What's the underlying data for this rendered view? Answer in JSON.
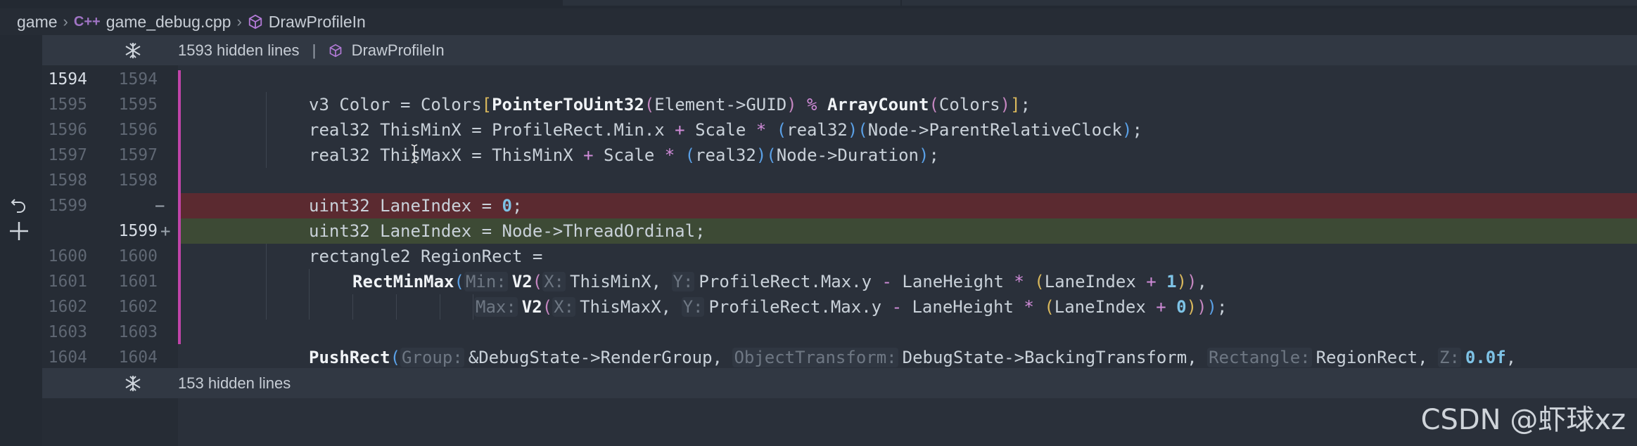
{
  "breadcrumb": {
    "folder": "game",
    "file_lang": "C++",
    "file": "game_debug.cpp",
    "symbol": "DrawProfileIn"
  },
  "top_fold": {
    "text": "1593 hidden lines",
    "divider": "|",
    "symbol": "DrawProfileIn"
  },
  "bottom_fold": {
    "text": "153 hidden lines"
  },
  "line_numbers": {
    "r1594_old": "1594",
    "r1594_new": "1594",
    "r1595_old": "1595",
    "r1595_new": "1595",
    "r1596_old": "1596",
    "r1596_new": "1596",
    "r1597_old": "1597",
    "r1597_new": "1597",
    "r1598_old": "1598",
    "r1598_new": "1598",
    "r1599_old": "1599",
    "r1599_new": "1599",
    "r1600_old": "1600",
    "r1600_new": "1600",
    "r1601_old": "1601",
    "r1601_new": "1601",
    "r1602_old": "1602",
    "r1602_new": "1602",
    "r1603_old": "1603",
    "r1603_new": "1603",
    "r1604_old": "1604",
    "r1604_new": "1604"
  },
  "diff_marks": {
    "removed": "−",
    "added": "+"
  },
  "code": {
    "l1595": {
      "a": "v3 Color = Colors",
      "b": "[",
      "c": "PointerToUint32",
      "d": "(",
      "e": "Element->GUID",
      "f": ")",
      "g": " % ",
      "h": "ArrayCount",
      "i": "(",
      "j": "Colors",
      "k": ")",
      "l": "]",
      "m": ";"
    },
    "l1596": {
      "a": "real32 ThisMinX = ProfileRect.Min.x ",
      "b": "+",
      "c": " Scale ",
      "d": "*",
      "e": " ",
      "f": "(",
      "g": "real32",
      "h": ")",
      "i": "(",
      "j": "Node->ParentRelativeClock",
      "k": ")",
      "l": ";"
    },
    "l1597": {
      "a": "real32 ThisMaxX = ThisMinX ",
      "b": "+",
      "c": " Scale ",
      "d": "*",
      "e": " ",
      "f": "(",
      "g": "real32",
      "h": ")",
      "i": "(",
      "j": "Node->Duration",
      "k": ")",
      "l": ";"
    },
    "l1599_del": {
      "a": "uint32 LaneIndex = ",
      "b": "0",
      "c": ";"
    },
    "l1599_add": {
      "a": "uint32 LaneIndex = Node->ThreadOrdinal;"
    },
    "l1600": {
      "a": "rectangle2 RegionRect ="
    },
    "l1601": {
      "fn": "RectMinMax",
      "p1": "(",
      "h1": "Min:",
      "fn2": "V2",
      "p2": "(",
      "h2": "X:",
      "a": "ThisMinX, ",
      "h3": "Y:",
      "b": "ProfileRect.Max.y ",
      "m": "-",
      "c": " LaneHeight ",
      "s": "*",
      "d": " ",
      "p3": "(",
      "e": "LaneIndex ",
      "pl": "+",
      "f": " ",
      "n": "1",
      "p4": ")",
      "p5": ")",
      "g": ","
    },
    "l1602": {
      "h1": "Max:",
      "fn2": "V2",
      "p2": "(",
      "h2": "X:",
      "a": "ThisMaxX, ",
      "h3": "Y:",
      "b": "ProfileRect.Max.y ",
      "m": "-",
      "c": " LaneHeight ",
      "s": "*",
      "d": " ",
      "p3": "(",
      "e": "LaneIndex ",
      "pl": "+",
      "f": " ",
      "n": "0",
      "p4": ")",
      "p5": ")",
      "p6": ")",
      "g": ";"
    },
    "l1604": {
      "fn": "PushRect",
      "p1": "(",
      "h1": "Group:",
      "a": "&DebugState->RenderGroup, ",
      "h2": "ObjectTransform:",
      "b": "DebugState->BackingTransform, ",
      "h3": "Rectangle:",
      "c": "RegionRect, ",
      "h4": "Z:",
      "n": "0.0f",
      "g": ","
    }
  },
  "watermark": "CSDN @虾球xz"
}
